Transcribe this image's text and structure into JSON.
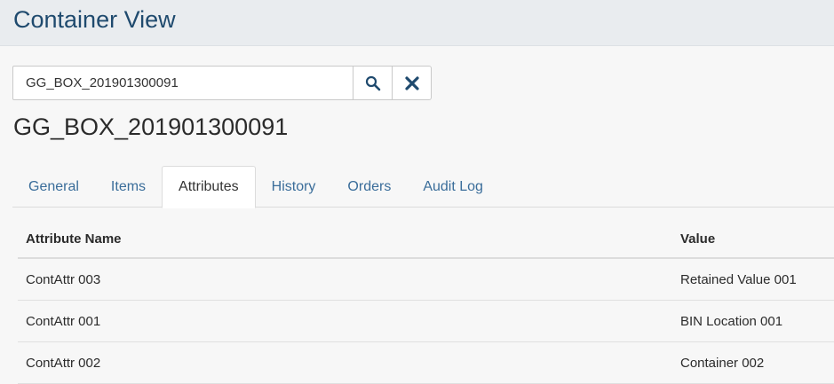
{
  "header": {
    "title": "Container View"
  },
  "search": {
    "value": "GG_BOX_201901300091"
  },
  "container": {
    "name": "GG_BOX_201901300091"
  },
  "tabs": [
    {
      "label": "General"
    },
    {
      "label": "Items"
    },
    {
      "label": "Attributes"
    },
    {
      "label": "History"
    },
    {
      "label": "Orders"
    },
    {
      "label": "Audit Log"
    }
  ],
  "active_tab": "Attributes",
  "table": {
    "columns": [
      "Attribute Name",
      "Value"
    ],
    "rows": [
      {
        "name": "ContAttr 003",
        "value": "Retained Value 001"
      },
      {
        "name": "ContAttr 001",
        "value": "BIN Location 001"
      },
      {
        "name": "ContAttr 002",
        "value": "Container 002"
      }
    ]
  },
  "icons": {
    "search": "search-icon",
    "clear": "close-icon"
  },
  "colors": {
    "title": "#1f4a6e",
    "link": "#3a6d9a",
    "header_bg": "#e9ecef"
  }
}
